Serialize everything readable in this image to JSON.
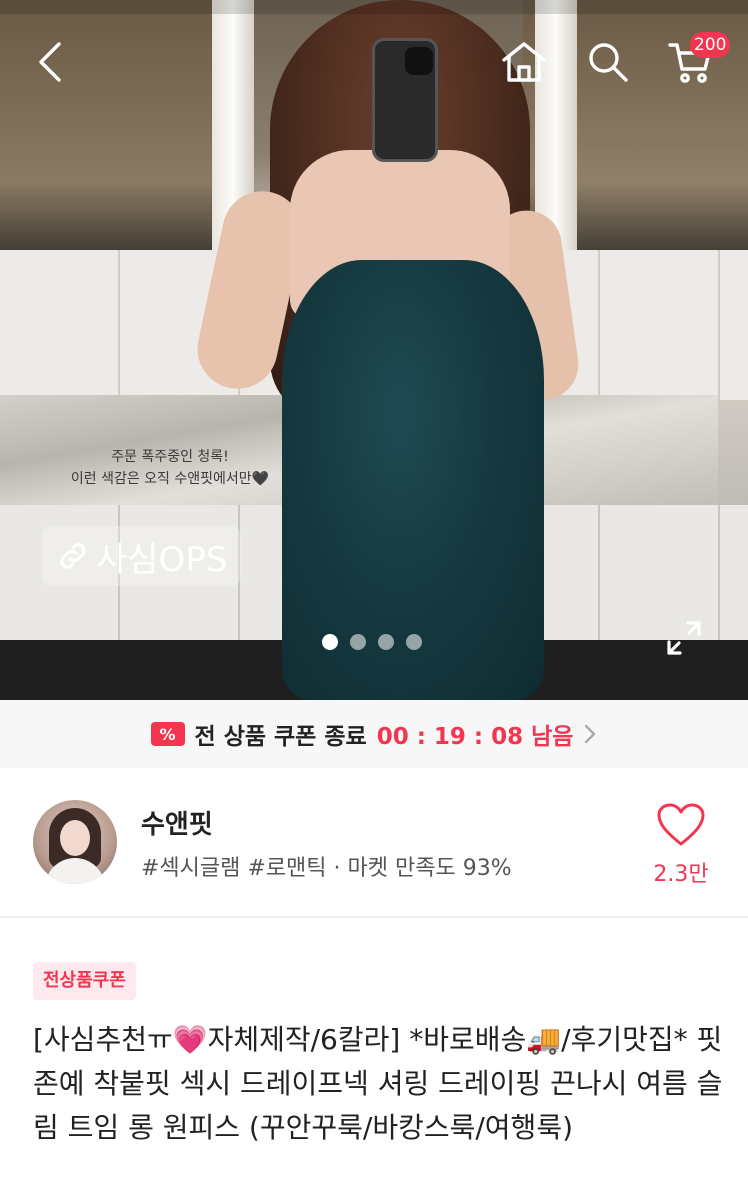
{
  "nav": {
    "cart_count": "200"
  },
  "hero": {
    "caption_line1": "주문 폭주중인 청록!",
    "caption_line2": "이런 색감은 오직 수앤핏에서만🖤",
    "badge_label": "사심OPS",
    "slide_count": 4,
    "active_slide": 1
  },
  "coupon": {
    "text": "전 상품 쿠폰 종료",
    "timer": "00 : 19 : 08 남음"
  },
  "shop": {
    "name": "수앤핏",
    "tags": "#섹시글램 #로맨틱 · 마켓 만족도 93%",
    "like_count": "2.3만"
  },
  "product": {
    "tag": "전상품쿠폰",
    "title": "[사심추천ㅠ💗자체제작/6칼라] *바로배송🚚/후기맛집* 핏 존예 착붙핏 섹시 드레이프넥 셔링 드레이핑 끈나시 여름 슬림 트임 롱 원피스 (꾸안꾸룩/바캉스룩/여행룩)"
  },
  "colors": {
    "accent": "#f2364f",
    "coupon_bg": "#f7f7f7",
    "tag_bg": "#fde9ee"
  }
}
